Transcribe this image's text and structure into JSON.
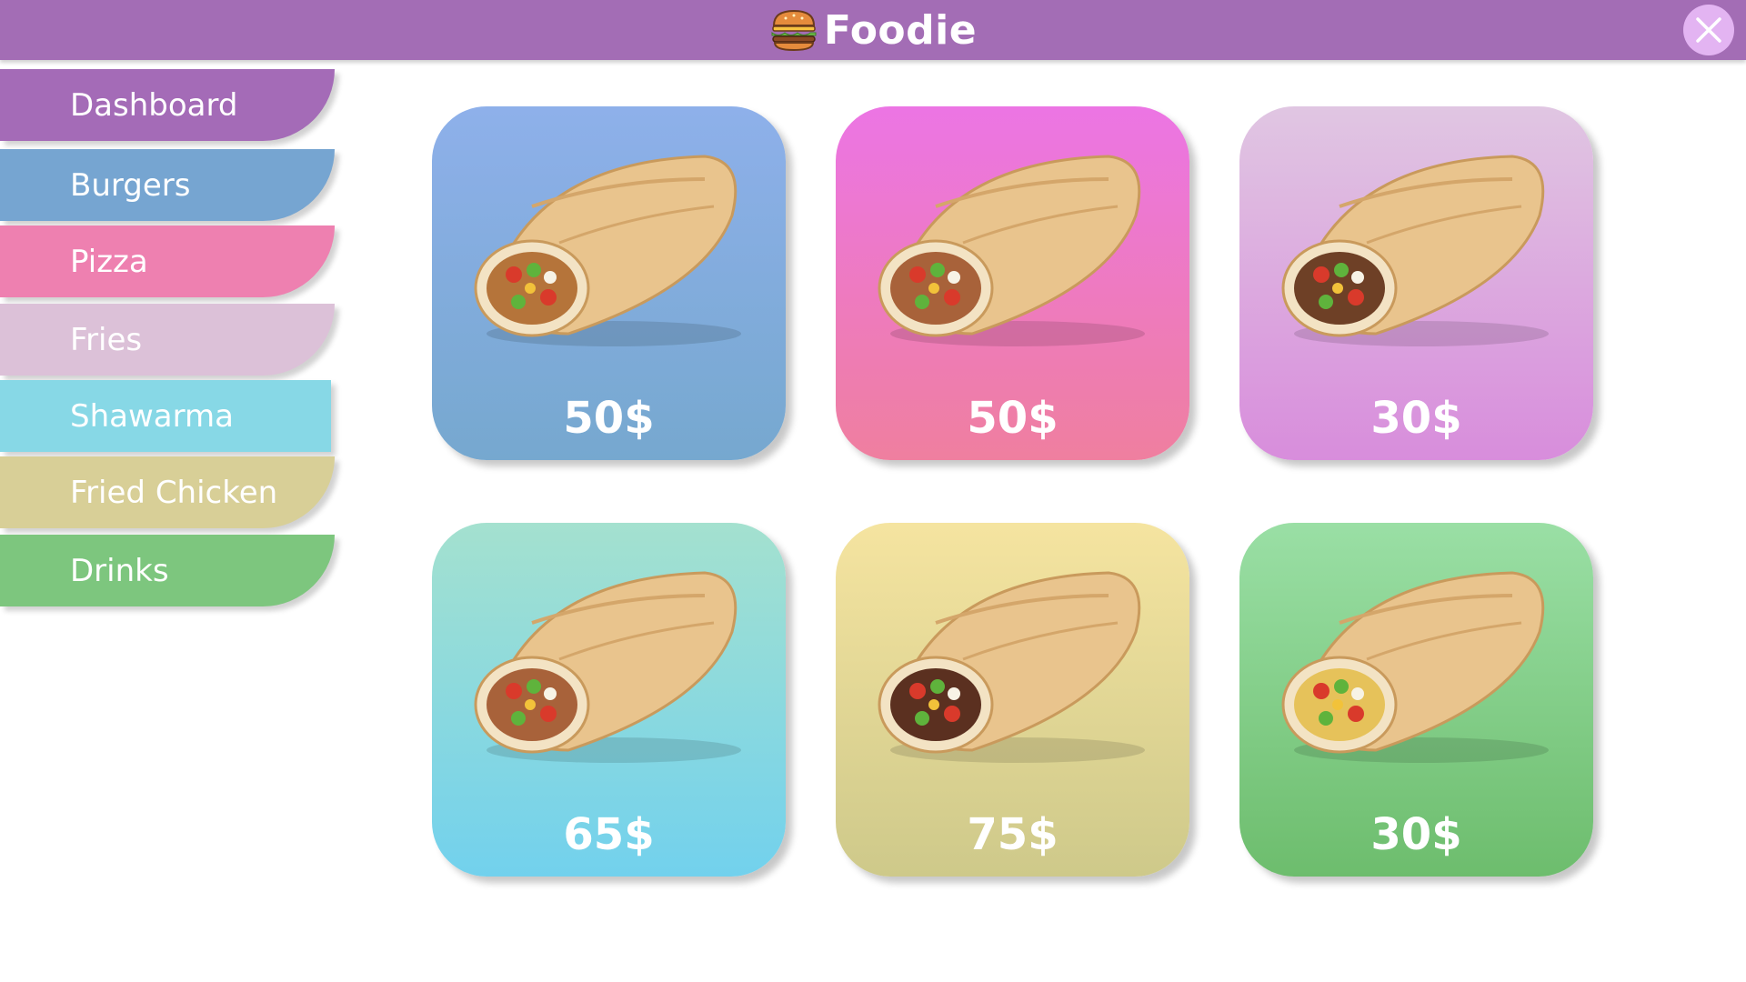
{
  "app": {
    "title": "Foodie",
    "icon": "burger-icon",
    "accent": "#a36db5"
  },
  "close": {
    "icon": "close-icon"
  },
  "sidebar": {
    "items": [
      {
        "label": "Dashboard",
        "color": "#a46bb7"
      },
      {
        "label": "Burgers",
        "color": "#76a5d1"
      },
      {
        "label": "Pizza",
        "color": "#ee80b0"
      },
      {
        "label": "Fries",
        "color": "#dcc1d8"
      },
      {
        "label": "Shawarma",
        "color": "#87d8e6"
      },
      {
        "label": "Fried Chicken",
        "color": "#d8cf97"
      },
      {
        "label": "Drinks",
        "color": "#7dc67e"
      }
    ]
  },
  "products": [
    {
      "price": "50$",
      "top": "#8eb0ea",
      "bottom": "#76a8cf",
      "image": "chicken-wrap-image"
    },
    {
      "price": "50$",
      "top": "#ec75e4",
      "bottom": "#ef7f9f",
      "image": "shawarma-wrap-image"
    },
    {
      "price": "30$",
      "top": "#e0c6e2",
      "bottom": "#d88ddc",
      "image": "beef-shawarma-image"
    },
    {
      "price": "65$",
      "top": "#a4e1cf",
      "bottom": "#72d1ed",
      "image": "shawarma-wrap-image"
    },
    {
      "price": "75$",
      "top": "#f5e4a0",
      "bottom": "#cec98a",
      "image": "beef-wrap-image"
    },
    {
      "price": "30$",
      "top": "#9adfa5",
      "bottom": "#6dbd6d",
      "image": "veggie-wrap-image"
    }
  ]
}
